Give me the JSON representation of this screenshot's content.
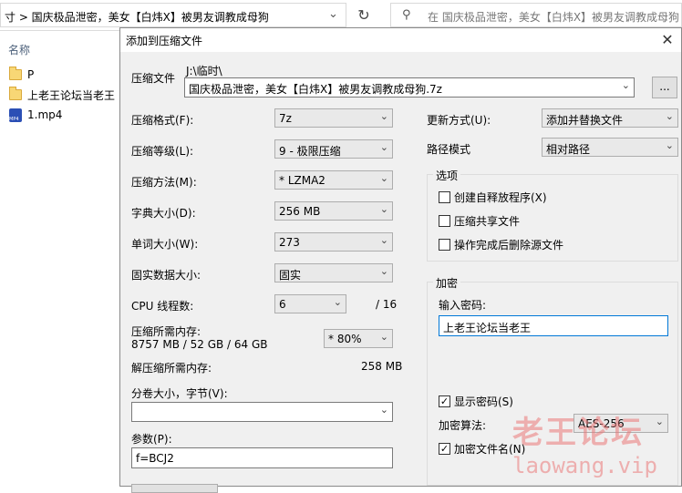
{
  "explorer": {
    "address_path": "寸  >  国庆极品泄密，美女【白炜X】被男友调教成母狗",
    "search_placeholder": "在 国庆极品泄密，美女【白炜X】被男友调教成母狗",
    "column_header": "名称",
    "files": [
      {
        "name": "P",
        "icon": "folder-icon"
      },
      {
        "name": "上老王论坛当老王",
        "icon": "folder-icon"
      },
      {
        "name": "1.mp4",
        "icon": "video-file-icon"
      }
    ]
  },
  "dialog": {
    "title": "添加到压缩文件",
    "archive_label": "压缩文件",
    "archive_dir": "J:\\临时\\",
    "archive_name": "国庆极品泄密，美女【白炜X】被男友调教成母狗.7z",
    "browse_label": "...",
    "format_label": "压缩格式(F):",
    "format_value": "7z",
    "level_label": "压缩等级(L):",
    "level_value": "9 - 极限压缩",
    "method_label": "压缩方法(M):",
    "method_value": "* LZMA2",
    "dict_label": "字典大小(D):",
    "dict_value": "256 MB",
    "word_label": "单词大小(W):",
    "word_value": "273",
    "solid_label": "固实数据大小:",
    "solid_value": "固实",
    "threads_label": "CPU 线程数:",
    "threads_value": "6",
    "threads_total": "/ 16",
    "mem_label": "压缩所需内存:",
    "mem_value": "8757 MB / 52 GB / 64 GB",
    "mem_percent": "* 80%",
    "decomp_mem_label": "解压缩所需内存:",
    "decomp_mem_value": "258 MB",
    "split_label": "分卷大小，字节(V):",
    "split_value": "",
    "params_label": "参数(P):",
    "params_value": "f=BCJ2",
    "update_label": "更新方式(U):",
    "update_value": "添加并替换文件",
    "path_mode_label": "路径模式",
    "path_mode_value": "相对路径",
    "options_title": "选项",
    "options": [
      {
        "label": "创建自释放程序(X)",
        "checked": false
      },
      {
        "label": "压缩共享文件",
        "checked": false
      },
      {
        "label": "操作完成后删除源文件",
        "checked": false
      }
    ],
    "encryption_title": "加密",
    "password_label": "输入密码:",
    "password_value": "上老王论坛当老王",
    "show_password_label": "显示密码(S)",
    "show_password_checked": true,
    "enc_method_label": "加密算法:",
    "enc_method_value": "AES-256",
    "encrypt_names_label": "加密文件名(N)",
    "encrypt_names_checked": true
  },
  "watermark": {
    "line1": "老王论坛",
    "line2": "laowang.vip"
  }
}
